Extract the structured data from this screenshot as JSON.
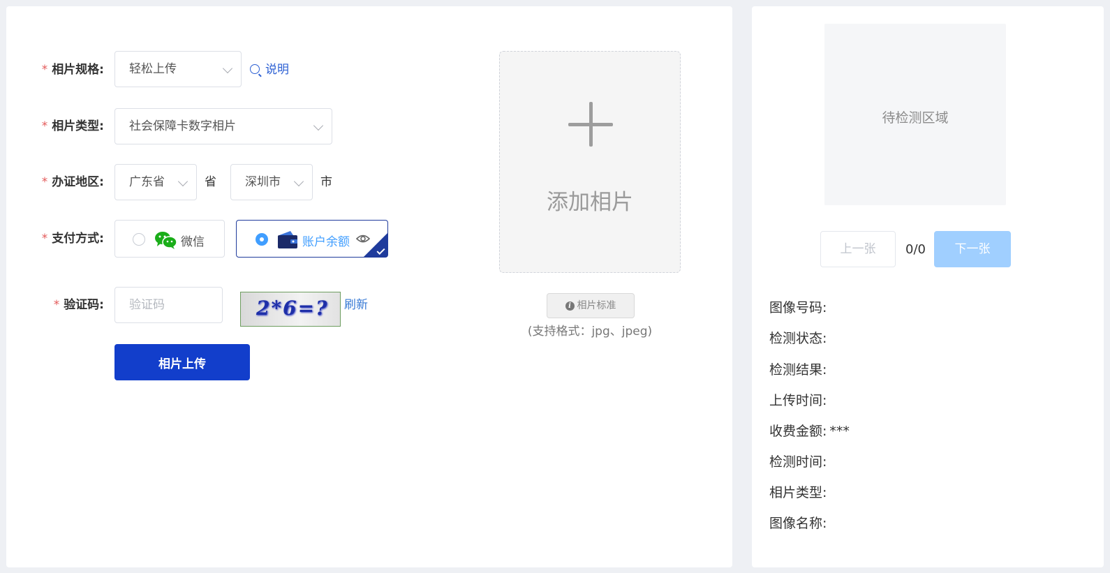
{
  "form": {
    "spec": {
      "label": "相片规格:",
      "value": "轻松上传",
      "help_label": "说明"
    },
    "type": {
      "label": "相片类型:",
      "value": "社会保障卡数字相片"
    },
    "region": {
      "label": "办证地区:",
      "province": "广东省",
      "province_suffix": "省",
      "city": "深圳市",
      "city_suffix": "市"
    },
    "payment": {
      "label": "支付方式:",
      "wechat_label": "微信",
      "balance_label": "账户余额",
      "selected": "账户余额"
    },
    "captcha": {
      "label": "验证码:",
      "placeholder": "验证码",
      "image_text": "2*6=?",
      "refresh_label": "刷新"
    },
    "submit_label": "相片上传"
  },
  "upload": {
    "add_label": "添加相片",
    "standard_button": "相片标准",
    "format_note": "(支持格式：jpg、jpeg)"
  },
  "preview": {
    "placeholder": "待检测区域",
    "prev_label": "上一张",
    "next_label": "下一张",
    "counter": "0/0"
  },
  "info": [
    {
      "label": "图像号码:",
      "value": ""
    },
    {
      "label": "检测状态:",
      "value": ""
    },
    {
      "label": "检测结果:",
      "value": ""
    },
    {
      "label": "上传时间:",
      "value": ""
    },
    {
      "label": "收费金额:",
      "value": "***"
    },
    {
      "label": "检测时间:",
      "value": ""
    },
    {
      "label": "相片类型:",
      "value": ""
    },
    {
      "label": "图像名称:",
      "value": ""
    }
  ],
  "colors": {
    "primary": "#123ecb",
    "required_star": "#e35a5a",
    "link": "#2b5fd3",
    "next_disabled": "#a0cfff"
  },
  "icons": [
    "search-icon",
    "chevron-down-icon",
    "wechat-icon",
    "wallet-icon",
    "eye-icon",
    "check-icon",
    "plus-icon",
    "info-icon"
  ]
}
